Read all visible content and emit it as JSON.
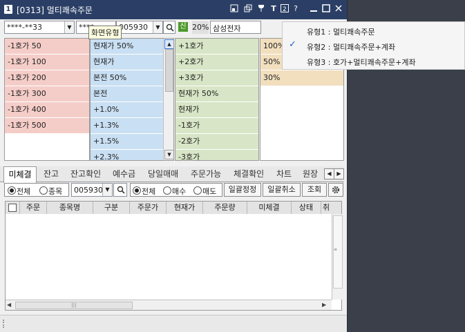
{
  "window": {
    "number": "1",
    "title": "[0313] 멀티쾌속주문",
    "title_icons": [
      "link-icon",
      "copy-window-icon",
      "pin-icon",
      "font-size-icon",
      "layout-2-icon",
      "help-icon",
      "minimize-icon",
      "maximize-icon",
      "close-icon"
    ]
  },
  "toolbar": {
    "account": "****-**33",
    "password": "****",
    "stock_code": "005930",
    "credit_badge": "신",
    "rate": "20%",
    "stock_name": "삼성전자"
  },
  "tooltip": "화면유형",
  "columns": {
    "red": [
      "-1호가 50",
      "-1호가 100",
      "-1호가 200",
      "-1호가 300",
      "-1호가 400",
      "-1호가 500"
    ],
    "blue": [
      "현재가 50%",
      "현재가",
      "본전 50%",
      "본전",
      "+1.0%",
      "+1.3%",
      "+1.5%",
      "+2.3%"
    ],
    "green": [
      "+1호가",
      "+2호가",
      "+3호가",
      "현재가 50%",
      "현재가",
      "-1호가",
      "-2호가",
      "-3호가"
    ],
    "tan": [
      "100%",
      "50%",
      "30%"
    ]
  },
  "popup": {
    "items": [
      {
        "label": "유형1 : 멀티쾌속주문",
        "checked": false
      },
      {
        "label": "유형2 : 멀티쾌속주문+계좌",
        "checked": true
      },
      {
        "label": "유형3 : 호가+멀티쾌속주문+계좌",
        "checked": false
      }
    ]
  },
  "tabs": [
    "미체결",
    "잔고",
    "잔고확인",
    "예수금",
    "당일매매",
    "주문가능",
    "체결확인",
    "차트",
    "원장"
  ],
  "active_tab": "미체결",
  "filter": {
    "all_label": "전체",
    "stock_label": "종목",
    "code": "005930",
    "side_all": "전체",
    "buy": "매수",
    "sell": "매도",
    "bulk_modify": "일괄정정",
    "bulk_cancel": "일괄취소",
    "query": "조회"
  },
  "grid_headers": [
    "주문",
    "종목명",
    "구분",
    "주문가",
    "현재가",
    "주문량",
    "미체결",
    "상태",
    "취"
  ],
  "colors": {
    "titlebar": "#2b3f66",
    "red_col": "#f5cdc8",
    "blue_col": "#c9dff3",
    "green_col": "#d8e5c6",
    "tan_col": "#f2dfbe",
    "credit_badge": "#4c9a2a"
  }
}
